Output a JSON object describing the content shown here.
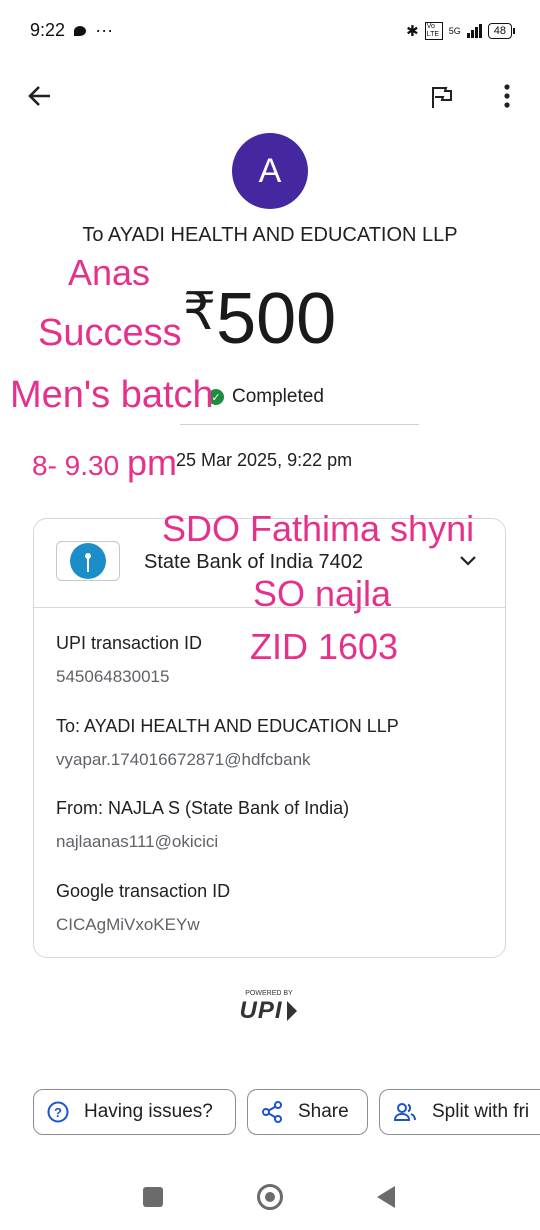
{
  "status_bar": {
    "time": "9:22",
    "dots": "···",
    "network": "5G",
    "volte": "Vo LTE",
    "battery": "48"
  },
  "app_bar": {
    "back_icon": "arrow-left-icon",
    "flag_icon": "flag-icon",
    "more_icon": "more-vert-icon"
  },
  "payee": {
    "avatar_letter": "A",
    "title": "To AYADI HEALTH AND EDUCATION LLP"
  },
  "amount": {
    "symbol": "₹",
    "value": "500"
  },
  "status": {
    "text": "Completed",
    "color": "#1e8e3e"
  },
  "datetime": "25 Mar 2025, 9:22 pm",
  "annotations": {
    "anas": "Anas",
    "success": "Success",
    "batch": "Men's batch",
    "time_prefix": "8- 9.30 ",
    "time_suffix": "pm",
    "sdo": "SDO Fathima shyni",
    "so": "SO najla",
    "zid": "ZID 1603",
    "color": "#e5318b"
  },
  "details": {
    "bank": "State Bank of India 7402",
    "upi_label": "UPI transaction ID",
    "upi_value": "545064830015",
    "to_label": "To: AYADI HEALTH AND EDUCATION LLP",
    "to_value": "vyapar.174016672871@hdfcbank",
    "from_label": "From: NAJLA  S (State Bank of India)",
    "from_value": "najlaanas111@okicici",
    "google_label": "Google transaction ID",
    "google_value": "CICAgMiVxoKEYw"
  },
  "upi": {
    "powered": "POWERED BY",
    "brand": "UPI"
  },
  "actions": {
    "issues": "Having issues?",
    "share": "Share",
    "split": "Split with fri"
  },
  "accent": "#4527a0"
}
